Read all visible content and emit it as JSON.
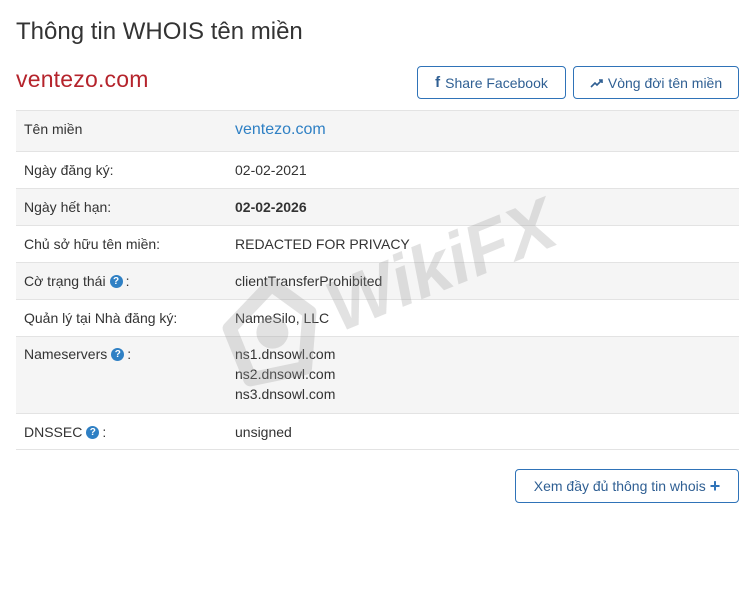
{
  "header": {
    "title": "Thông tin WHOIS tên miền",
    "domain": "ventezo.com"
  },
  "buttons": {
    "share_facebook": "Share Facebook",
    "domain_lifecycle": "Vòng đời tên miền",
    "view_full_whois": "Xem đầy đủ thông tin whois"
  },
  "rows": {
    "domain": {
      "label": "Tên miền",
      "value": "ventezo.com"
    },
    "registered": {
      "label": "Ngày đăng ký:",
      "value": "02-02-2021"
    },
    "expires": {
      "label": "Ngày hết hạn:",
      "value": "02-02-2026"
    },
    "owner": {
      "label": "Chủ sở hữu tên miền:",
      "value": "REDACTED FOR PRIVACY"
    },
    "status": {
      "label": "Cờ trạng thái",
      "suffix": ":",
      "value": "clientTransferProhibited"
    },
    "registrar": {
      "label": "Quản lý tại Nhà đăng ký:",
      "value": "NameSilo, LLC"
    },
    "nameservers": {
      "label": "Nameservers",
      "suffix": ":",
      "values": [
        "ns1.dnsowl.com",
        "ns2.dnsowl.com",
        "ns3.dnsowl.com"
      ]
    },
    "dnssec": {
      "label": "DNSSEC",
      "suffix": ":",
      "value": "unsigned"
    }
  },
  "help_icon_glyph": "?",
  "watermark": {
    "text": "WikiFX"
  },
  "colors": {
    "brand_red": "#b5242c",
    "link_blue": "#2f80c4",
    "button_border": "#2f73b8"
  }
}
